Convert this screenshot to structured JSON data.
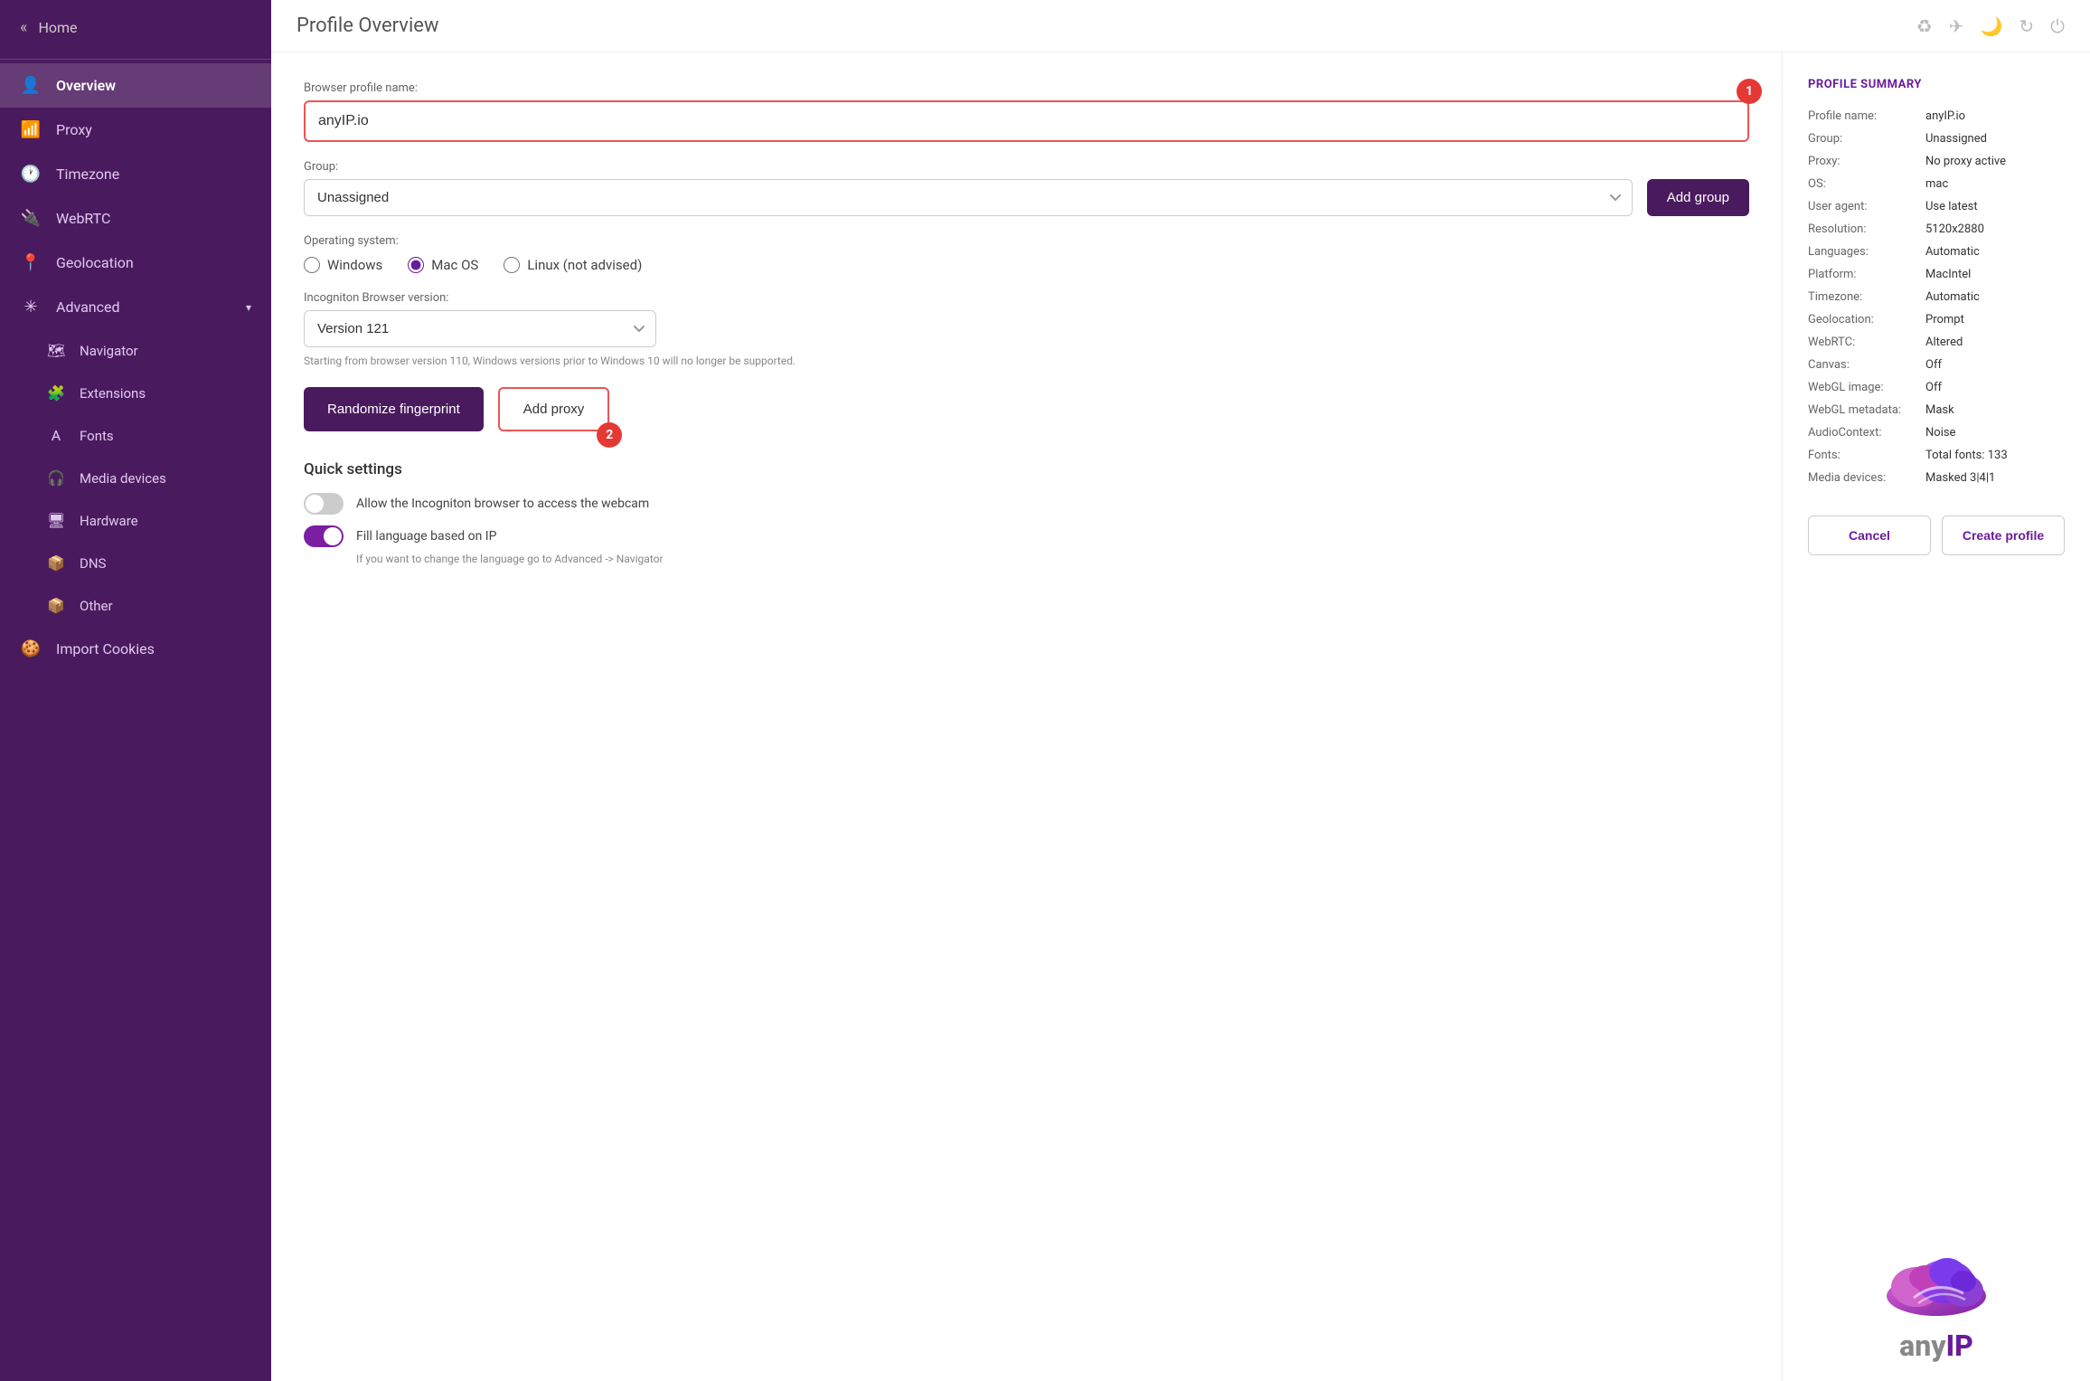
{
  "sidebar": {
    "home_label": "Home",
    "back_icon": "«",
    "items": [
      {
        "id": "overview",
        "label": "Overview",
        "icon": "👤",
        "active": true
      },
      {
        "id": "proxy",
        "label": "Proxy",
        "icon": "📶"
      },
      {
        "id": "timezone",
        "label": "Timezone",
        "icon": "🕐"
      },
      {
        "id": "webrtc",
        "label": "WebRTC",
        "icon": "🔌"
      },
      {
        "id": "geolocation",
        "label": "Geolocation",
        "icon": "📍"
      },
      {
        "id": "advanced",
        "label": "Advanced",
        "icon": "✳",
        "has_arrow": true
      },
      {
        "id": "navigator",
        "label": "Navigator",
        "icon": "🗺",
        "sub": true
      },
      {
        "id": "extensions",
        "label": "Extensions",
        "icon": "🧩",
        "sub": true
      },
      {
        "id": "fonts",
        "label": "Fonts",
        "icon": "A",
        "sub": true
      },
      {
        "id": "media-devices",
        "label": "Media devices",
        "icon": "🎧",
        "sub": true
      },
      {
        "id": "hardware",
        "label": "Hardware",
        "icon": "🖥",
        "sub": true
      },
      {
        "id": "dns",
        "label": "DNS",
        "icon": "📦",
        "sub": true
      },
      {
        "id": "other",
        "label": "Other",
        "icon": "📦",
        "sub": true
      },
      {
        "id": "import-cookies",
        "label": "Import Cookies",
        "icon": "🍪"
      }
    ]
  },
  "topbar": {
    "title": "Profile Overview",
    "icons": [
      "♻",
      "✈",
      "🌙",
      "↻",
      "⏻"
    ]
  },
  "form": {
    "profile_name_label": "Browser profile name:",
    "profile_name_value": "anyIP.io",
    "group_label": "Group:",
    "group_value": "Unassigned",
    "group_options": [
      "Unassigned"
    ],
    "add_group_label": "Add group",
    "os_label": "Operating system:",
    "os_options": [
      {
        "value": "windows",
        "label": "Windows",
        "checked": false
      },
      {
        "value": "macos",
        "label": "Mac OS",
        "checked": true
      },
      {
        "value": "linux",
        "label": "Linux (not advised)",
        "checked": false
      }
    ],
    "browser_version_label": "Incogniton Browser version:",
    "browser_version_value": "Version 121",
    "browser_version_options": [
      "Version 121"
    ],
    "version_note": "Starting from browser version 110, Windows versions prior to Windows 10 will no longer be supported.",
    "randomize_btn": "Randomize fingerprint",
    "add_proxy_btn": "Add proxy",
    "quick_settings_title": "Quick settings",
    "webcam_toggle_label": "Allow the Incogniton browser to access the webcam",
    "webcam_toggle_on": false,
    "language_toggle_label": "Fill language based on IP",
    "language_toggle_on": true,
    "language_sublabel": "If you want to change the language go to Advanced -> Navigator",
    "badge_1": "1",
    "badge_2": "2"
  },
  "summary": {
    "title": "PROFILE SUMMARY",
    "rows": [
      {
        "key": "Profile name:",
        "val": "anyIP.io"
      },
      {
        "key": "Group:",
        "val": "Unassigned"
      },
      {
        "key": "Proxy:",
        "val": "No proxy active"
      },
      {
        "key": "OS:",
        "val": "mac"
      },
      {
        "key": "User agent:",
        "val": "Use latest"
      },
      {
        "key": "Resolution:",
        "val": "5120x2880"
      },
      {
        "key": "Languages:",
        "val": "Automatic"
      },
      {
        "key": "Platform:",
        "val": "MacIntel"
      },
      {
        "key": "Timezone:",
        "val": "Automatic"
      },
      {
        "key": "Geolocation:",
        "val": "Prompt"
      },
      {
        "key": "WebRTC:",
        "val": "Altered"
      },
      {
        "key": "Canvas:",
        "val": "Off"
      },
      {
        "key": "WebGL image:",
        "val": "Off"
      },
      {
        "key": "WebGL metadata:",
        "val": "Mask"
      },
      {
        "key": "AudioContext:",
        "val": "Noise"
      },
      {
        "key": "Fonts:",
        "val": "Total fonts: 133"
      },
      {
        "key": "Media devices:",
        "val": "Masked 3|4|1"
      }
    ],
    "cancel_btn": "Cancel",
    "create_btn": "Create profile"
  },
  "logo": {
    "text_prefix": "any",
    "text_suffix": "IP"
  }
}
